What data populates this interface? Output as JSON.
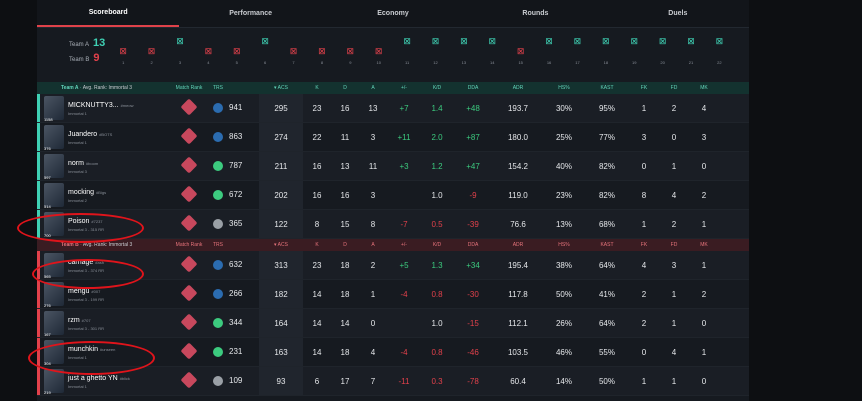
{
  "tabs": [
    "Scoreboard",
    "Performance",
    "Economy",
    "Rounds",
    "Duels"
  ],
  "teams": {
    "a": {
      "label": "Team A",
      "score": "13",
      "color": "#3fd1b4"
    },
    "b": {
      "label": "Team B",
      "score": "9",
      "color": "#e2414b"
    }
  },
  "rounds": [
    {
      "n": "1",
      "w": "b"
    },
    {
      "n": "2",
      "w": "b"
    },
    {
      "n": "3",
      "w": "a"
    },
    {
      "n": "4",
      "w": "b"
    },
    {
      "n": "5",
      "w": "b"
    },
    {
      "n": "6",
      "w": "a"
    },
    {
      "n": "7",
      "w": "b"
    },
    {
      "n": "8",
      "w": "b"
    },
    {
      "n": "9",
      "w": "b"
    },
    {
      "n": "10",
      "w": "b"
    },
    {
      "n": "11",
      "w": "a"
    },
    {
      "n": "12",
      "w": "a"
    },
    {
      "n": "13",
      "w": "a"
    },
    {
      "n": "14",
      "w": "a"
    },
    {
      "n": "15",
      "w": "b"
    },
    {
      "n": "16",
      "w": "a"
    },
    {
      "n": "17",
      "w": "a"
    },
    {
      "n": "18",
      "w": "a"
    },
    {
      "n": "19",
      "w": "a"
    },
    {
      "n": "20",
      "w": "a"
    },
    {
      "n": "21",
      "w": "a"
    },
    {
      "n": "22",
      "w": "a"
    }
  ],
  "columns": {
    "match_rank": "Match Rank",
    "trs": "TRS",
    "acs": "ACS",
    "k": "K",
    "d": "D",
    "a": "A",
    "pm": "+/-",
    "kd": "K/D",
    "dda": "DDA",
    "adr": "ADR",
    "hs": "HS%",
    "kast": "KAST",
    "fk": "FK",
    "fd": "FD",
    "mk": "MK"
  },
  "team_a_header": {
    "team": "Team A",
    "avg": "Avg. Rank:",
    "rank": "Immortal 3"
  },
  "team_b_header": {
    "team": "Team B",
    "avg": "Avg. Rank:",
    "rank": "Immortal 3"
  },
  "team_a_players": [
    {
      "name": "MICKNUTTY3...",
      "tag": "#meow",
      "rank": "Immortal 1",
      "lvl": "1158",
      "trs": "941",
      "acs": "295",
      "k": "23",
      "d": "16",
      "a": "13",
      "pm": "+7",
      "kd": "1.4",
      "dda": "+48",
      "adr": "193.7",
      "hs": "30%",
      "kast": "95%",
      "fk": "1",
      "fd": "2",
      "mk": "4"
    },
    {
      "name": "Juandero",
      "tag": "#BOTS",
      "rank": "Immortal 1",
      "lvl": "376",
      "trs": "863",
      "acs": "274",
      "k": "22",
      "d": "11",
      "a": "3",
      "pm": "+11",
      "kd": "2.0",
      "dda": "+87",
      "adr": "180.0",
      "hs": "25%",
      "kast": "77%",
      "fk": "3",
      "fd": "0",
      "mk": "3"
    },
    {
      "name": "norm",
      "tag": "#boom",
      "rank": "Immortal 3",
      "lvl": "597",
      "trs": "787",
      "acs": "211",
      "k": "16",
      "d": "13",
      "a": "11",
      "pm": "+3",
      "kd": "1.2",
      "dda": "+47",
      "adr": "154.2",
      "hs": "40%",
      "kast": "82%",
      "fk": "0",
      "fd": "1",
      "mk": "0"
    },
    {
      "name": "mocking",
      "tag": "#Bigs",
      "rank": "Immortal 2",
      "lvl": "514",
      "trs": "672",
      "acs": "202",
      "k": "16",
      "d": "16",
      "a": "3",
      "pm": "",
      "kd": "1.0",
      "dda": "-9",
      "adr": "119.0",
      "hs": "23%",
      "kast": "82%",
      "fk": "8",
      "fd": "4",
      "mk": "2"
    },
    {
      "name": "Poison",
      "tag": "#7237",
      "rank": "Immortal 3 - 315 RR",
      "lvl": "700",
      "trs": "365",
      "acs": "122",
      "k": "8",
      "d": "15",
      "a": "8",
      "pm": "-7",
      "kd": "0.5",
      "dda": "-39",
      "adr": "76.6",
      "hs": "13%",
      "kast": "68%",
      "fk": "1",
      "fd": "2",
      "mk": "1"
    }
  ],
  "team_b_players": [
    {
      "name": "carnage",
      "tag": "#ash",
      "rank": "Immortal 3 - 374 RR",
      "lvl": "565",
      "trs": "632",
      "acs": "313",
      "k": "23",
      "d": "18",
      "a": "2",
      "pm": "+5",
      "kd": "1.3",
      "dda": "+34",
      "adr": "195.4",
      "hs": "38%",
      "kast": "64%",
      "fk": "4",
      "fd": "3",
      "mk": "1"
    },
    {
      "name": "mengu",
      "tag": "#007",
      "rank": "Immortal 3 - 199 RR",
      "lvl": "276",
      "trs": "266",
      "acs": "182",
      "k": "14",
      "d": "18",
      "a": "1",
      "pm": "-4",
      "kd": "0.8",
      "dda": "-30",
      "adr": "117.8",
      "hs": "50%",
      "kast": "41%",
      "fk": "2",
      "fd": "1",
      "mk": "2"
    },
    {
      "name": "rzm",
      "tag": "#707",
      "rank": "Immortal 3 - 301 RR",
      "lvl": "167",
      "trs": "344",
      "acs": "164",
      "k": "14",
      "d": "14",
      "a": "0",
      "pm": "",
      "kd": "1.0",
      "dda": "-15",
      "adr": "112.1",
      "hs": "26%",
      "kast": "64%",
      "fk": "2",
      "fd": "1",
      "mk": "0"
    },
    {
      "name": "munchkin",
      "tag": "#unseen",
      "rank": "Immortal 1",
      "lvl": "304",
      "trs": "231",
      "acs": "163",
      "k": "14",
      "d": "18",
      "a": "4",
      "pm": "-4",
      "kd": "0.8",
      "dda": "-46",
      "adr": "103.5",
      "hs": "46%",
      "kast": "55%",
      "fk": "0",
      "fd": "4",
      "mk": "1"
    },
    {
      "name": "just a ghetto YN",
      "tag": "#blick",
      "rank": "Immortal 1",
      "lvl": "219",
      "trs": "109",
      "acs": "93",
      "k": "6",
      "d": "17",
      "a": "7",
      "pm": "-11",
      "kd": "0.3",
      "dda": "-78",
      "adr": "60.4",
      "hs": "14%",
      "kast": "50%",
      "fk": "1",
      "fd": "1",
      "mk": "0"
    }
  ],
  "colors": {
    "accent": "#e0424a",
    "positive": "#3ccb7f",
    "negative": "#e2414b",
    "team_a": "#3fd1b4",
    "team_b": "#e2414b"
  }
}
